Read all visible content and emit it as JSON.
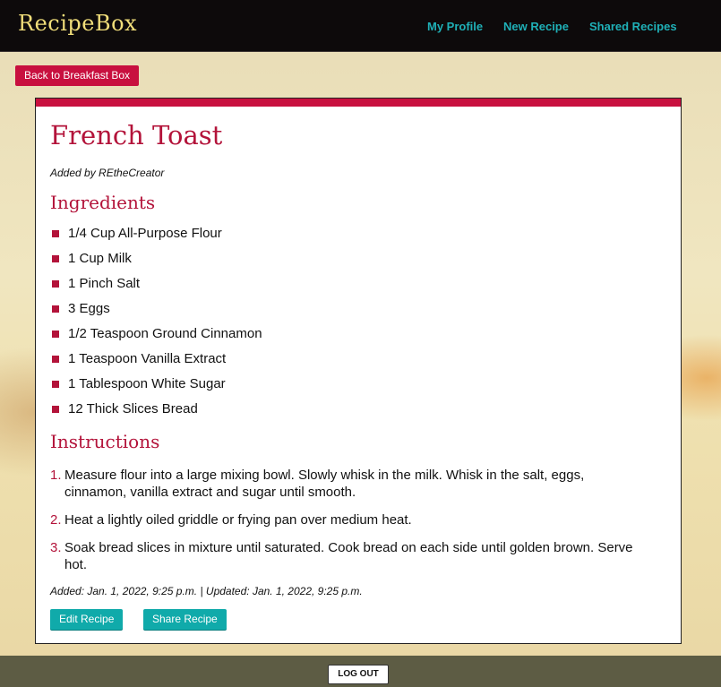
{
  "navbar": {
    "brand": "RecipeBox",
    "links": [
      "My Profile",
      "New Recipe",
      "Shared Recipes"
    ]
  },
  "back_button": "Back to Breakfast Box",
  "recipe": {
    "title": "French Toast",
    "added_by": "Added by REtheCreator",
    "ingredients_heading": "Ingredients",
    "ingredients": [
      "1/4 Cup All-Purpose Flour",
      "1 Cup Milk",
      "1 Pinch Salt",
      "3 Eggs",
      "1/2 Teaspoon Ground Cinnamon",
      "1 Teaspoon Vanilla Extract",
      "1 Tablespoon White Sugar",
      "12 Thick Slices Bread"
    ],
    "instructions_heading": "Instructions",
    "instructions": [
      {
        "num": "1.",
        "text": "Measure flour into a large mixing bowl. Slowly whisk in the milk. Whisk in the salt, eggs, cinnamon, vanilla extract and sugar until smooth."
      },
      {
        "num": "2.",
        "text": "Heat a lightly oiled griddle or frying pan over medium heat."
      },
      {
        "num": "3.",
        "text": "Soak bread slices in mixture until saturated. Cook bread on each side until golden brown. Serve hot."
      }
    ],
    "dates": "Added: Jan. 1, 2022, 9:25 p.m. | Updated: Jan. 1, 2022, 9:25 p.m.",
    "edit_button": "Edit Recipe",
    "share_button": "Share Recipe"
  },
  "footer": {
    "logout": "LOG OUT"
  },
  "colors": {
    "accent": "#c8103f",
    "teal": "#1fb0b7",
    "brand": "#f1de7a"
  }
}
